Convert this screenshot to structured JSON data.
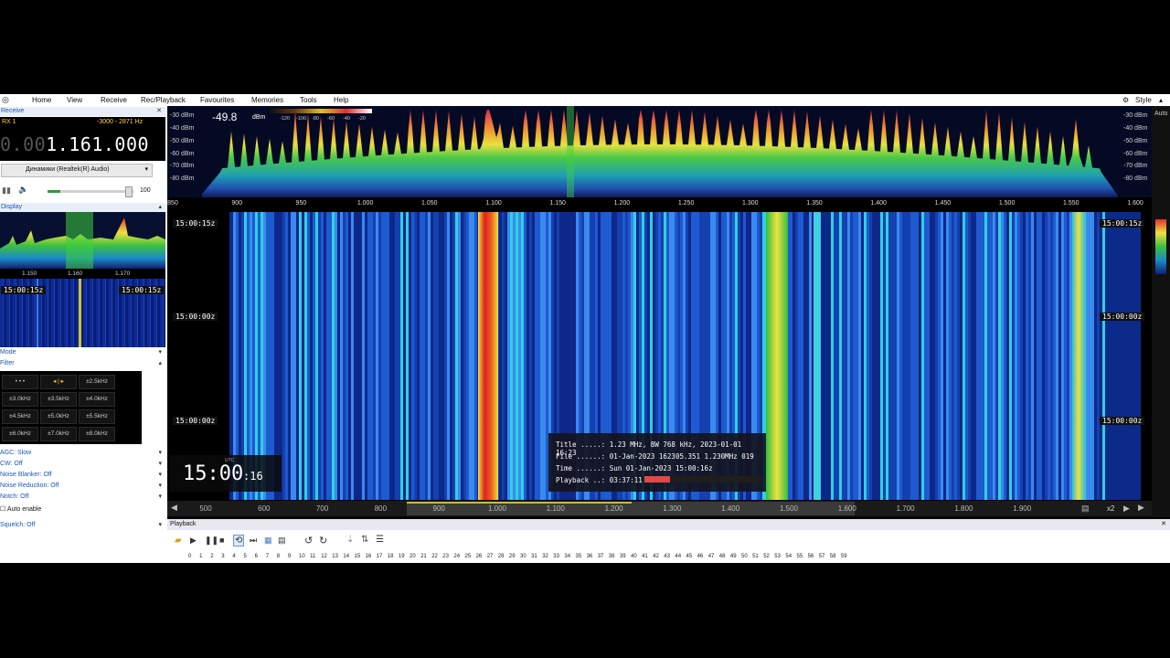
{
  "menu": {
    "items": [
      "Home",
      "View",
      "Receive",
      "Rec/Playback",
      "Favourites",
      "Memories",
      "Tools",
      "Help"
    ],
    "style_label": "Style"
  },
  "receive_panel": {
    "title": "Receive",
    "rx_label": "RX 1",
    "filter_range": "-3000 - 2871 Hz",
    "frequency_dim": "0.00",
    "frequency_main": "1.161.000",
    "audio_device": "Динамики (Realtek(R) Audio)",
    "volume": "100"
  },
  "mini_display": {
    "title": "Display",
    "ticks": [
      "1.150",
      "1.160",
      "1.170"
    ],
    "time_left": "15:00:15z",
    "time_right": "15:00:15z"
  },
  "mode_header": "Mode",
  "filter_header": "Filter",
  "filter_buttons": [
    "• • •",
    "◂ | ▸",
    "±2.5kHz",
    "±3.0kHz",
    "±3.5kHz",
    "±4.0kHz",
    "±4.5kHz",
    "±5.0kHz",
    "±5.5kHz",
    "±6.0kHz",
    "±7.0kHz",
    "±8.0kHz"
  ],
  "options": {
    "agc": "AGC: Slow",
    "cw": "CW: Off",
    "noise_blanker": "Noise Blanker: Off",
    "noise_reduction": "Noise Reduction: Off",
    "notch": "Notch: Off",
    "auto_enable": "Auto enable",
    "squelch": "Squelch: Off"
  },
  "spectrum": {
    "level_readout": "-49.8",
    "level_unit": "dBm",
    "colorbar_ticks": [
      "-120",
      "-100",
      "-80",
      "-60",
      "-40",
      "-20"
    ],
    "db_ticks_left": [
      "-30 dBm",
      "-40 dBm",
      "-50 dBm",
      "-60 dBm",
      "-70 dBm",
      "-80 dBm"
    ],
    "db_ticks_right": [
      "-30 dBm",
      "-40 dBm",
      "-50 dBm",
      "-60 dBm",
      "-70 dBm",
      "-80 dBm"
    ],
    "auto_label": "Auto",
    "freq_ticks": [
      "850",
      "900",
      "950",
      "1.000",
      "1.050",
      "1.100",
      "1.150",
      "1.200",
      "1.250",
      "1.300",
      "1.350",
      "1.400",
      "1.450",
      "1.500",
      "1.550",
      "1.600"
    ]
  },
  "waterfall": {
    "time_labels": [
      "15:00:15z",
      "15:00:00z",
      "15:00:00z"
    ],
    "freq_ticks": [
      "500",
      "600",
      "700",
      "800",
      "900",
      "1.000",
      "1.100",
      "1.200",
      "1.300",
      "1.400",
      "1.500",
      "1.600",
      "1.700",
      "1.800",
      "1.900"
    ],
    "zoom": "x2"
  },
  "info_box": {
    "title": "Title .....: 1.23 MHz, BW 768 kHz, 2023-01-01 16:23",
    "file": "File ......: 01-Jan-2023 162305.351 1.230MHz 019",
    "time": "Time ......: Sun 01-Jan-2023 15:00:16z",
    "playback": "Playback ..: 03:37:11",
    "progress": 0.22
  },
  "clock": {
    "utc_label": "UTC",
    "hhmm": "15:00",
    "seconds": ":16"
  },
  "playback_panel": {
    "title": "Playback",
    "seconds_ruler": [
      "0",
      "1",
      "2",
      "3",
      "4",
      "5",
      "6",
      "7",
      "8",
      "9",
      "10",
      "11",
      "12",
      "13",
      "14",
      "15",
      "16",
      "17",
      "18",
      "19",
      "20",
      "21",
      "22",
      "23",
      "24",
      "25",
      "26",
      "27",
      "28",
      "29",
      "30",
      "31",
      "32",
      "33",
      "34",
      "35",
      "36",
      "37",
      "38",
      "39",
      "40",
      "41",
      "42",
      "43",
      "44",
      "45",
      "46",
      "47",
      "48",
      "49",
      "50",
      "51",
      "52",
      "53",
      "54",
      "55",
      "56",
      "57",
      "58",
      "59"
    ]
  },
  "colors": {
    "accent_blue": "#1a56b8",
    "waterfall_bg": "#0b2a8a",
    "progress_red": "#e04848"
  }
}
